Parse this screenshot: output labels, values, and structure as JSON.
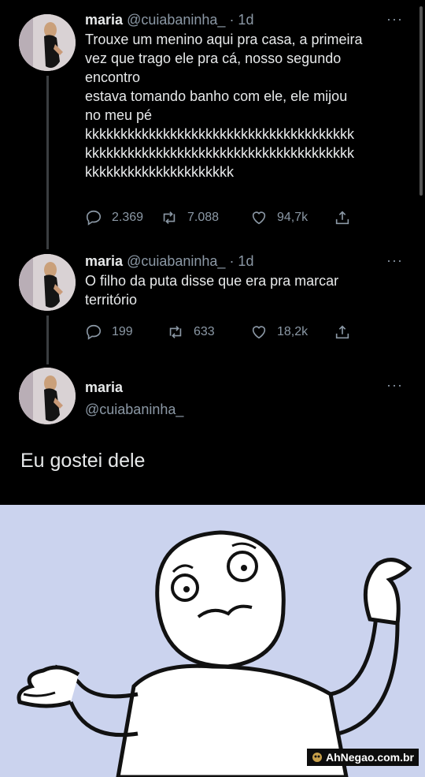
{
  "tweets": [
    {
      "name": "maria",
      "handle": "@cuiabaninha_",
      "time": " · 1d",
      "text_lines": [
        "Trouxe um menino aqui pra casa, a primeira",
        "vez que trago ele pra cá, nosso segundo",
        "encontro",
        "estava tomando banho com ele, ele mijou",
        "no meu pé",
        "kkkkkkkkkkkkkkkkkkkkkkkkkkkkkkkkkkkkkk",
        "kkkkkkkkkkkkkkkkkkkkkkkkkkkkkkkkkkkkkk",
        "kkkkkkkkkkkkkkkkkkkkk"
      ],
      "replies": "2.369",
      "retweets": "7.088",
      "likes": "94,7k"
    },
    {
      "name": "maria",
      "handle": "@cuiabaninha_",
      "time": " · 1d",
      "text_lines": [
        "O filho da puta disse que era pra marcar",
        "território"
      ],
      "replies": "199",
      "retweets": "633",
      "likes": "18,2k"
    }
  ],
  "main_tweet": {
    "name": "maria",
    "handle": "@cuiabaninha_",
    "text": "Eu gostei dele"
  },
  "watermark": "AhNegao.com.br",
  "more_glyph": "···",
  "colors": {
    "background": "#000000",
    "text": "#e7e9ea",
    "muted": "#8b98a5",
    "meme_bg": "#cbd3ee"
  }
}
